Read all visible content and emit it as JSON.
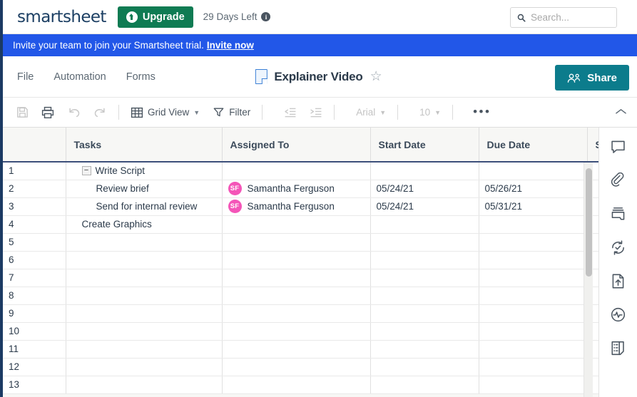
{
  "header": {
    "logo": "smartsheet",
    "upgrade_label": "Upgrade",
    "upgrade_icon": "arrow-up-circle-icon",
    "trial_days": "29 Days Left",
    "info_icon": "i",
    "search_placeholder": "Search...",
    "search_value": "",
    "search_icon": "search-icon",
    "accent_green": "#0f7b53"
  },
  "banner": {
    "text": "Invite your team to join your Smartsheet trial.",
    "link": "Invite now",
    "color": "#2257e8"
  },
  "menubar": {
    "items": [
      {
        "label": "File"
      },
      {
        "label": "Automation"
      },
      {
        "label": "Forms"
      }
    ],
    "sheet_icon": "sheet-document-icon",
    "sheet_title": "Explainer Video",
    "favorite_icon": "☆",
    "share_label": "Share",
    "share_icon": "people-icon",
    "share_color": "#0c7c8c"
  },
  "toolbar": {
    "save_label": "save-icon",
    "print_label": "print-icon",
    "undo_label": "undo-icon",
    "redo_label": "redo-icon",
    "view_label": "Grid View",
    "view_icon": "grid-icon",
    "filter_label": "Filter",
    "filter_icon": "funnel-icon",
    "outdent_icon": "outdent-icon",
    "indent_icon": "indent-icon",
    "font_family_value": "Arial",
    "font_size_value": "10",
    "more_label": "•••",
    "collapse_icon": "chevron-up-icon"
  },
  "grid": {
    "columns": [
      {
        "key": "rownum",
        "label": "",
        "selected": false
      },
      {
        "key": "tasks",
        "label": "Tasks",
        "selected": false
      },
      {
        "key": "assigned",
        "label": "Assigned To",
        "selected": true
      },
      {
        "key": "start",
        "label": "Start Date",
        "selected": false
      },
      {
        "key": "due",
        "label": "Due Date",
        "selected": false
      },
      {
        "key": "status",
        "label": "S",
        "selected": false
      }
    ],
    "rows": [
      {
        "num": "1",
        "task": "Write Script",
        "indent": 0,
        "collapse": "−",
        "assignee": "",
        "initials": "",
        "start": "",
        "due": ""
      },
      {
        "num": "2",
        "task": "Review brief",
        "indent": 1,
        "collapse": "",
        "assignee": "Samantha Ferguson",
        "initials": "SF",
        "start": "05/24/21",
        "due": "05/26/21"
      },
      {
        "num": "3",
        "task": "Send for internal review",
        "indent": 1,
        "collapse": "",
        "assignee": "Samantha Ferguson",
        "initials": "SF",
        "start": "05/24/21",
        "due": "05/31/21"
      },
      {
        "num": "4",
        "task": "Create Graphics",
        "indent": 0,
        "collapse": "",
        "assignee": "",
        "initials": "",
        "start": "",
        "due": ""
      },
      {
        "num": "5",
        "task": "",
        "indent": 0,
        "collapse": "",
        "assignee": "",
        "initials": "",
        "start": "",
        "due": ""
      },
      {
        "num": "6",
        "task": "",
        "indent": 0,
        "collapse": "",
        "assignee": "",
        "initials": "",
        "start": "",
        "due": ""
      },
      {
        "num": "7",
        "task": "",
        "indent": 0,
        "collapse": "",
        "assignee": "",
        "initials": "",
        "start": "",
        "due": ""
      },
      {
        "num": "8",
        "task": "",
        "indent": 0,
        "collapse": "",
        "assignee": "",
        "initials": "",
        "start": "",
        "due": ""
      },
      {
        "num": "9",
        "task": "",
        "indent": 0,
        "collapse": "",
        "assignee": "",
        "initials": "",
        "start": "",
        "due": ""
      },
      {
        "num": "10",
        "task": "",
        "indent": 0,
        "collapse": "",
        "assignee": "",
        "initials": "",
        "start": "",
        "due": ""
      },
      {
        "num": "11",
        "task": "",
        "indent": 0,
        "collapse": "",
        "assignee": "",
        "initials": "",
        "start": "",
        "due": ""
      },
      {
        "num": "12",
        "task": "",
        "indent": 0,
        "collapse": "",
        "assignee": "",
        "initials": "",
        "start": "",
        "due": ""
      },
      {
        "num": "13",
        "task": "",
        "indent": 0,
        "collapse": "",
        "assignee": "",
        "initials": "",
        "start": "",
        "due": ""
      }
    ],
    "avatar_color": "#f455b8",
    "selected_col_color": "#4a90d9"
  },
  "right_sidebar": {
    "icons": [
      {
        "name": "comments-icon"
      },
      {
        "name": "attachments-icon"
      },
      {
        "name": "proofs-icon"
      },
      {
        "name": "update-requests-icon"
      },
      {
        "name": "publish-icon"
      },
      {
        "name": "activity-log-icon"
      },
      {
        "name": "summary-icon"
      }
    ]
  }
}
